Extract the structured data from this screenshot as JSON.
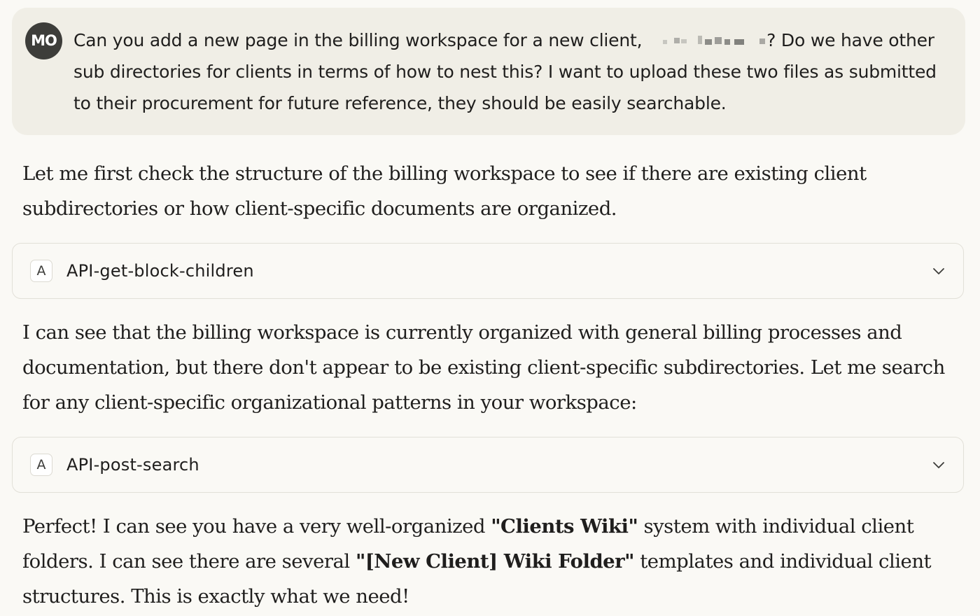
{
  "user_message": {
    "avatar": "MO",
    "text_before": "Can you add a new page in the billing workspace for a new client, ",
    "text_after": "? Do we have other sub directories for clients in terms of how to nest this? I want to upload these two files as submitted to their procurement for future reference, they should be easily searchable."
  },
  "assistant": {
    "para1": "Let me first check the structure of the billing workspace to see if there are existing client subdirectories or how client-specific documents are organized.",
    "tool1": {
      "badge": "A",
      "name": "API-get-block-children",
      "icon": "chevron-down-icon"
    },
    "para2": "I can see that the billing workspace is currently organized with general billing processes and documentation, but there don't appear to be existing client-specific subdirectories. Let me search for any client-specific organizational patterns in your workspace:",
    "tool2": {
      "badge": "A",
      "name": "API-post-search",
      "icon": "chevron-down-icon"
    },
    "para3": {
      "t1": "Perfect! I can see you have a very well-organized ",
      "b1": "\"Clients Wiki\"",
      "t2": " system with individual client folders. I can see there are several ",
      "b2": "\"[New Client] Wiki Folder\"",
      "t3": " templates and individual client structures. This is exactly what we need!"
    }
  },
  "colors": {
    "background": "#faf9f5",
    "user_bubble": "#f0eee6",
    "avatar": "#3d3d3a",
    "text": "#1f1e1d",
    "card_border": "#e2e0d8"
  }
}
